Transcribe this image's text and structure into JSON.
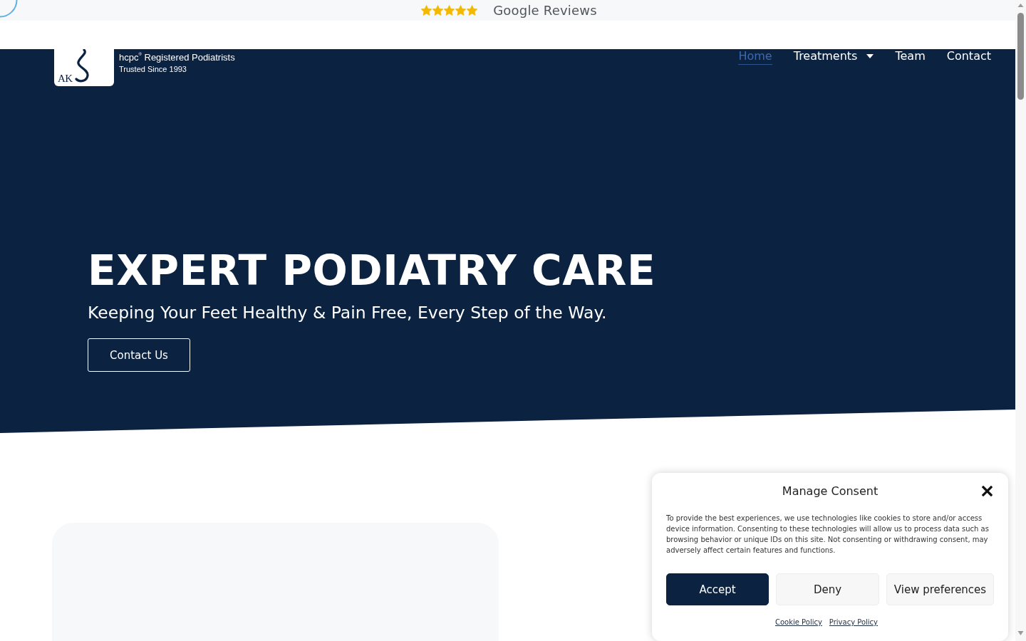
{
  "top_bar": {
    "rating": {
      "stars": 5
    },
    "label": "Google Reviews"
  },
  "header": {
    "logo": {
      "initials": "AK",
      "tagline": "hcpc$^{®}$ Registered Podiatrists",
      "since": "Trusted Since 1993"
    },
    "nav": [
      {
        "label": "Home",
        "selected": true,
        "dropdown": false
      },
      {
        "label": "Treatments",
        "selected": false,
        "dropdown": true
      },
      {
        "label": "Team",
        "selected": false,
        "dropdown": false
      },
      {
        "label": "Contact",
        "selected": false,
        "dropdown": false
      }
    ]
  },
  "hero": {
    "title": "EXPERT PODIATRY CARE",
    "subtitle": "Keeping Your Feet Healthy & Pain Free, Every Step of the Way.",
    "button": "Contact Us"
  },
  "consent": {
    "title": "Manage Consent",
    "text": "To provide the best experiences, we use technologies like cookies to store and/or access device information. Consenting to these technologies will allow us to process data such as browsing behavior or unique IDs on this site. Not consenting or withdrawing consent, may adversely affect certain features and functions.",
    "buttons": [
      {
        "label": "Accept",
        "kind": "primary"
      },
      {
        "label": "Deny",
        "kind": "secondary"
      },
      {
        "label": "View preferences",
        "kind": "secondary"
      }
    ],
    "links": [
      "Cookie Policy",
      "Privacy Policy"
    ]
  }
}
